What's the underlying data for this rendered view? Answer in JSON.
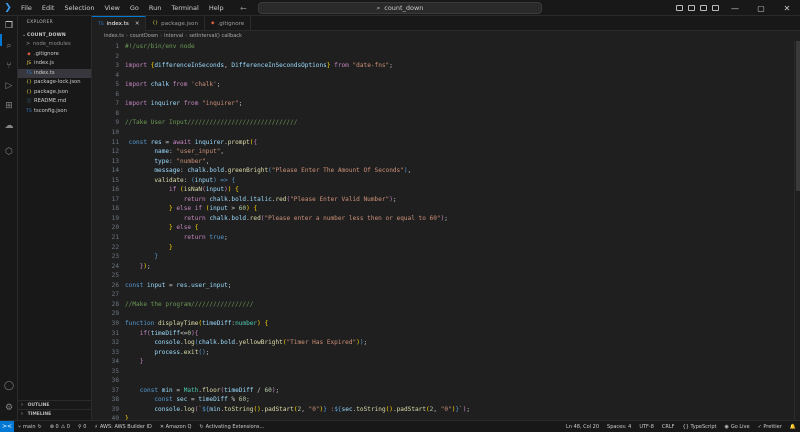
{
  "titlebar": {
    "menu": [
      "File",
      "Edit",
      "Selection",
      "View",
      "Go",
      "Run",
      "Terminal",
      "Help"
    ],
    "search_text": "count_down",
    "window_controls": [
      "—",
      "▢",
      "✕"
    ]
  },
  "explorer": {
    "title": "EXPLORER",
    "project": "COUNT_DOWN",
    "items": [
      {
        "icon": ">",
        "label": "node_modules",
        "type": "folder"
      },
      {
        "icon": "◆",
        "label": ".gitignore",
        "type": "file",
        "color": "#e05d44"
      },
      {
        "icon": "JS",
        "label": "index.js",
        "type": "file",
        "color": "#e8d44d"
      },
      {
        "icon": "TS",
        "label": "index.ts",
        "type": "file",
        "color": "#3178c6",
        "selected": true
      },
      {
        "icon": "{}",
        "label": "package-lock.json",
        "type": "file",
        "color": "#e8d44d"
      },
      {
        "icon": "{}",
        "label": "package.json",
        "type": "file",
        "color": "#e8d44d"
      },
      {
        "icon": "ⓘ",
        "label": "README.md",
        "type": "file",
        "color": "#519aba"
      },
      {
        "icon": "TS",
        "label": "tsconfig.json",
        "type": "file",
        "color": "#3178c6"
      }
    ],
    "outline_label": "OUTLINE",
    "timeline_label": "TIMELINE"
  },
  "tabs": [
    {
      "icon": "TS",
      "label": "index.ts",
      "active": true
    },
    {
      "icon": "{}",
      "label": "package.json",
      "active": false
    },
    {
      "icon": "◆",
      "label": ".gitignore",
      "active": false
    }
  ],
  "breadcrumb": [
    "index.ts",
    "countDown",
    "interval",
    "setInterval() callback"
  ],
  "code": [
    {
      "n": 1,
      "html": "<span class='c'>#!/usr/bin/env node</span>"
    },
    {
      "n": 2,
      "html": ""
    },
    {
      "n": 3,
      "html": "<span class='kc'>import</span> <span class='p'>{</span><span class='v'>differenceInSeconds</span>, <span class='v'>DifferenceInSecondsOptions</span><span class='p'>}</span> <span class='kc'>from</span> <span class='s'>\"date-fns\"</span>;"
    },
    {
      "n": 4,
      "html": ""
    },
    {
      "n": 5,
      "html": "<span class='kc'>import</span> <span class='v'>chalk</span> <span class='kc'>from</span> <span class='s'>'chalk'</span>;"
    },
    {
      "n": 6,
      "html": ""
    },
    {
      "n": 7,
      "html": "<span class='kc'>import</span> <span class='v'>inquirer</span> <span class='kc'>from</span> <span class='s'>\"inquirer\"</span>;"
    },
    {
      "n": 8,
      "html": ""
    },
    {
      "n": 9,
      "html": "<span class='c'>//Take User Input//////////////////////////////</span>"
    },
    {
      "n": 10,
      "html": ""
    },
    {
      "n": 11,
      "html": " <span class='k'>const</span> <span class='v'>res</span> = <span class='kc'>await</span> <span class='v'>inquirer</span>.<span class='f'>prompt</span><span class='p'>(</span><span class='kc'>{</span>"
    },
    {
      "n": 12,
      "html": "        <span class='v'>name</span>: <span class='s'>\"user_input\"</span>,"
    },
    {
      "n": 13,
      "html": "        <span class='v'>type</span>: <span class='s'>\"number\"</span>,"
    },
    {
      "n": 14,
      "html": "        <span class='v'>message</span>: <span class='v'>chalk</span>.<span class='v'>bold</span>.<span class='f'>greenBright</span><span class='k'>(</span><span class='s'>\"Please Enter The Amount Of Seconds\"</span><span class='k'>)</span>,"
    },
    {
      "n": 15,
      "html": "        <span class='f'>validate</span>: <span class='k'>(</span><span class='v'>input</span><span class='k'>)</span> <span class='k'>=&gt;</span> <span class='k'>{</span>"
    },
    {
      "n": 16,
      "html": "            <span class='kc'>if</span> <span class='p'>(</span><span class='f'>isNaN</span><span class='kc'>(</span><span class='v'>input</span><span class='kc'>)</span><span class='p'>)</span> <span class='p'>{</span>"
    },
    {
      "n": 17,
      "html": "                <span class='kc'>return</span> <span class='v'>chalk</span>.<span class='v'>bold</span>.<span class='v'>italic</span>.<span class='f'>red</span><span class='kc'>(</span><span class='s'>\"Please Enter Valid Number\"</span><span class='kc'>)</span>;"
    },
    {
      "n": 18,
      "html": "            <span class='p'>}</span> <span class='kc'>else if</span> <span class='p'>(</span><span class='v'>input</span> &gt; <span class='n'>60</span><span class='p'>)</span> <span class='p'>{</span>"
    },
    {
      "n": 19,
      "html": "                <span class='kc'>return</span> <span class='v'>chalk</span>.<span class='v'>bold</span>.<span class='f'>red</span><span class='kc'>(</span><span class='s'>\"Please enter a number less then or equal to 60\"</span><span class='kc'>)</span>;"
    },
    {
      "n": 20,
      "html": "            <span class='p'>}</span> <span class='kc'>else</span> <span class='p'>{</span>"
    },
    {
      "n": 21,
      "html": "                <span class='kc'>return</span> <span class='k'>true</span>;"
    },
    {
      "n": 22,
      "html": "            <span class='p'>}</span>"
    },
    {
      "n": 23,
      "html": "        <span class='k'>}</span>"
    },
    {
      "n": 24,
      "html": "    <span class='kc'>}</span><span class='p'>)</span>;"
    },
    {
      "n": 25,
      "html": ""
    },
    {
      "n": 26,
      "html": "<span class='k'>const</span> <span class='v'>input</span> = <span class='v'>res</span>.<span class='v'>user_input</span>;"
    },
    {
      "n": 27,
      "html": ""
    },
    {
      "n": 28,
      "html": "<span class='c'>//Make the program/////////////////</span>"
    },
    {
      "n": 29,
      "html": ""
    },
    {
      "n": 30,
      "html": "<span class='k'>function</span> <span class='f'>displayTime</span><span class='p'>(</span><span class='v'>timeDiff</span>:<span class='t'>number</span><span class='p'>)</span> <span class='p'>{</span>"
    },
    {
      "n": 31,
      "html": "    <span class='kc'>if</span><span class='kc'>(</span><span class='v'>timeDiff</span>&lt;=<span class='n'>0</span><span class='kc'>)</span><span class='kc'>{</span>"
    },
    {
      "n": 32,
      "html": "        <span class='v'>console</span>.<span class='f'>log</span><span class='k'>(</span><span class='v'>chalk</span>.<span class='v'>bold</span>.<span class='f'>yellowBright</span><span class='p'>(</span><span class='s'>\"Timer Has Expired\"</span><span class='p'>)</span><span class='k'>)</span>;"
    },
    {
      "n": 33,
      "html": "        <span class='v'>process</span>.<span class='f'>exit</span><span class='k'>()</span>;"
    },
    {
      "n": 34,
      "html": "    <span class='kc'>}</span>"
    },
    {
      "n": 35,
      "html": ""
    },
    {
      "n": 36,
      "html": ""
    },
    {
      "n": 37,
      "html": "    <span class='k'>const</span> <span class='v'>min</span> = <span class='t'>Math</span>.<span class='f'>floor</span><span class='kc'>(</span><span class='v'>timeDiff</span> / <span class='n'>60</span><span class='kc'>)</span>;"
    },
    {
      "n": 38,
      "html": "        <span class='k'>const</span> <span class='v'>sec</span> = <span class='v'>timeDiff</span> % <span class='n'>60</span>;"
    },
    {
      "n": 39,
      "html": "        <span class='v'>console</span>.<span class='f'>log</span><span class='kc'>(</span><span class='s'>`</span><span class='k'>${</span><span class='v'>min</span>.<span class='f'>toString</span><span class='p'>()</span>.<span class='f'>padStart</span><span class='p'>(</span><span class='n'>2</span>, <span class='s'>\"0\"</span><span class='p'>)</span><span class='k'>}</span><span class='s'> :</span><span class='k'>${</span><span class='v'>sec</span>.<span class='f'>toString</span><span class='p'>()</span>.<span class='f'>padStart</span><span class='p'>(</span><span class='n'>2</span>, <span class='s'>\"0\"</span><span class='p'>)</span><span class='k'>}</span><span class='s'>`</span><span class='kc'>)</span>;"
    },
    {
      "n": 40,
      "html": "<span class='p'>}</span>"
    }
  ],
  "statusbar": {
    "remote_icon": "><",
    "branch": "main",
    "sync": "↻",
    "errors": "⊗ 0",
    "warnings": "⚠ 0",
    "ports": "⚲ 0",
    "aws": "AWS: AWS Builder ID",
    "amazon_q": "✕ Amazon Q",
    "extensions": "Activating Extensions...",
    "position": "Ln 48, Col 20",
    "spaces": "Spaces: 4",
    "encoding": "UTF-8",
    "eol": "CRLF",
    "language": "{} TypeScript",
    "golive": "Go Live",
    "prettier": "✓ Prettier",
    "bell": "🔔"
  }
}
